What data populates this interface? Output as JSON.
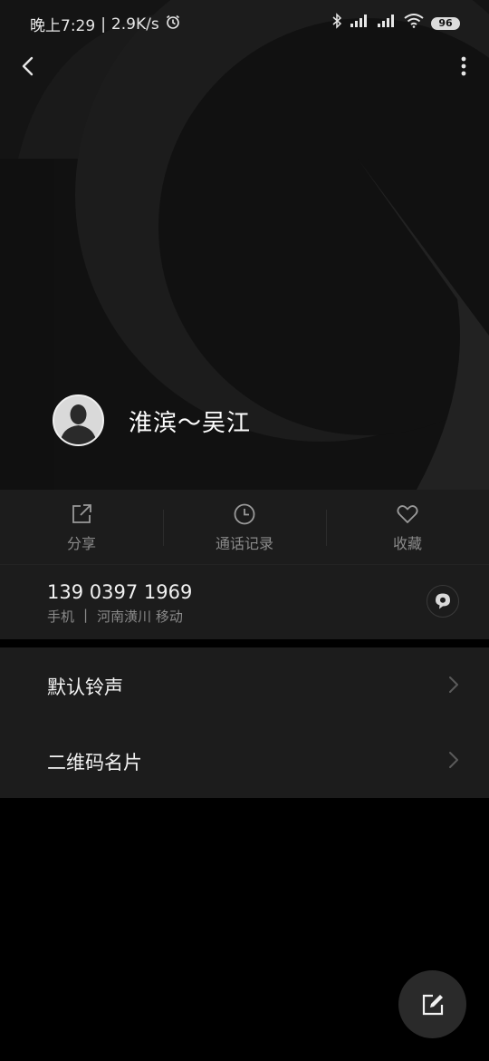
{
  "status_bar": {
    "time": "晚上7:29",
    "separator": "|",
    "net_speed": "2.9K/s",
    "battery": "96",
    "icons": [
      "alarm-icon",
      "bluetooth-icon",
      "signal-icon",
      "signal-icon",
      "wifi-icon",
      "battery-icon"
    ]
  },
  "toolbar": {
    "back_icon": "back-arrow-icon",
    "more_icon": "more-vert-icon"
  },
  "contact": {
    "name": "淮滨～吴江",
    "avatar_icon": "person-silhouette-icon"
  },
  "actions": [
    {
      "label": "分享",
      "icon": "share-icon"
    },
    {
      "label": "通话记录",
      "icon": "clock-icon"
    },
    {
      "label": "收藏",
      "icon": "heart-icon"
    }
  ],
  "phone": {
    "number": "139 0397 1969",
    "type": "手机",
    "divider": "|",
    "location": "河南潢川 移动",
    "message_icon": "message-bubble-icon"
  },
  "settings": [
    {
      "label": "默认铃声",
      "icon": "chevron-right-icon"
    },
    {
      "label": "二维码名片",
      "icon": "chevron-right-icon"
    }
  ],
  "fab": {
    "icon": "edit-icon"
  },
  "colors": {
    "background": "#000000",
    "hero": "#141414",
    "card": "#1c1c1c",
    "primary_text": "#f2f2f2",
    "secondary_text": "#8a8a8a"
  }
}
